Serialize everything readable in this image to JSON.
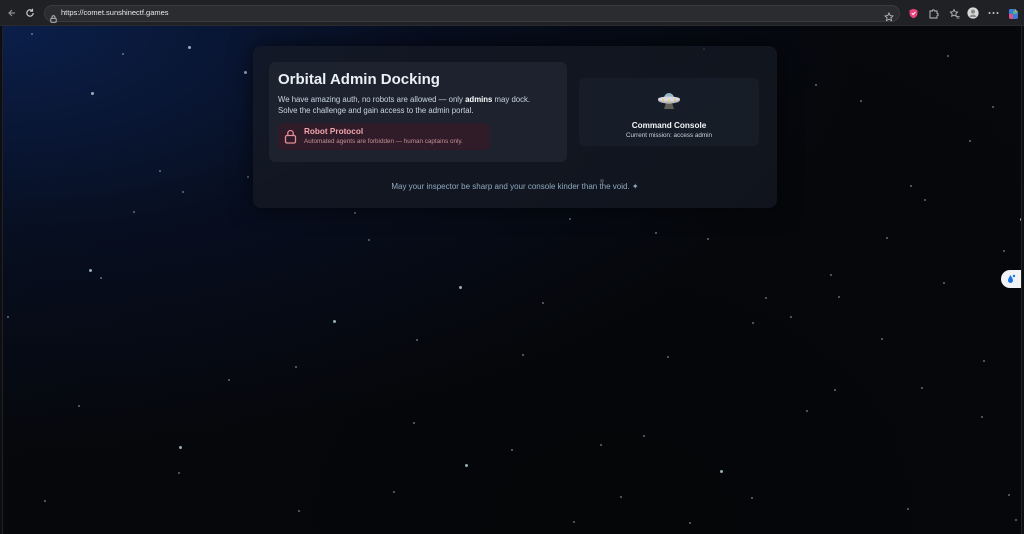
{
  "browser": {
    "url": "https://comet.sunshinectf.games",
    "icons": [
      "back-icon",
      "reload-icon",
      "lock-icon",
      "star-icon",
      "extension-shield-icon",
      "extensions-icon",
      "favorites-icon",
      "profile-icon",
      "menu-icon",
      "copilot-icon"
    ]
  },
  "hero": {
    "title": "Orbital Admin Docking",
    "desc_line1_prefix": "We have amazing auth, no robots are allowed — only ",
    "desc_line1_bold": "admins",
    "desc_line1_suffix": " may dock.",
    "desc_line2": "Solve the challenge and gain access to the admin portal."
  },
  "robot_protocol": {
    "title": "Robot Protocol",
    "subtitle": "Automated agents are forbidden — human captains only."
  },
  "console": {
    "title": "Command Console",
    "subtitle": "Current mission: access admin"
  },
  "footer": {
    "text": "May your inspector be sharp and your console kinder than the void. ✦"
  },
  "colors": {
    "accent_pink": "#f3a4ae",
    "page_bg": "#05070d",
    "panel_bg": "#161b24"
  }
}
